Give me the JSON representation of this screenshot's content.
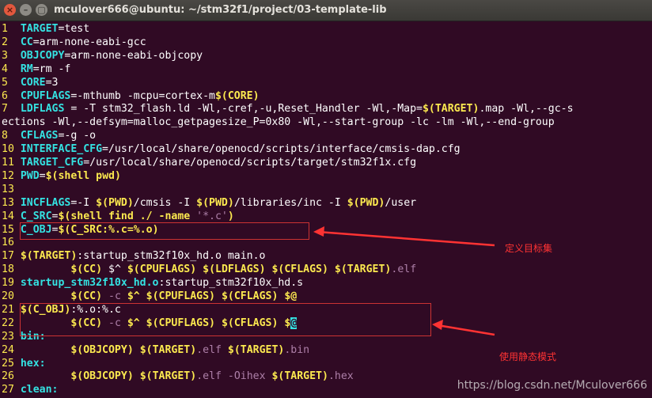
{
  "window": {
    "title": "mculover666@ubuntu: ~/stm32f1/project/03-template-lib",
    "close_glyph": "×",
    "min_glyph": "–",
    "max_glyph": "▢"
  },
  "lines": [
    {
      "n": "1",
      "segs": [
        {
          "t": "TARGET",
          "c": "cyan b"
        },
        {
          "t": "=test",
          "c": ""
        }
      ]
    },
    {
      "n": "2",
      "segs": [
        {
          "t": "CC",
          "c": "cyan b"
        },
        {
          "t": "=arm-none-eabi-gcc",
          "c": ""
        }
      ]
    },
    {
      "n": "3",
      "segs": [
        {
          "t": "OBJCOPY",
          "c": "cyan b"
        },
        {
          "t": "=arm-none-eabi-objcopy",
          "c": ""
        }
      ]
    },
    {
      "n": "4",
      "segs": [
        {
          "t": "RM",
          "c": "cyan b"
        },
        {
          "t": "=rm -f",
          "c": ""
        }
      ]
    },
    {
      "n": "5",
      "segs": [
        {
          "t": "CORE",
          "c": "cyan b"
        },
        {
          "t": "=3",
          "c": ""
        }
      ]
    },
    {
      "n": "6",
      "segs": [
        {
          "t": "CPUFLAGS",
          "c": "cyan b"
        },
        {
          "t": "=-mthumb -mcpu=cortex-m",
          "c": ""
        },
        {
          "t": "$(CORE)",
          "c": "yel b"
        }
      ]
    },
    {
      "n": "7",
      "segs": [
        {
          "t": "LDFLAGS",
          "c": "cyan b"
        },
        {
          "t": " = -T stm32_flash.ld -Wl,-cref,-u,Reset_Handler -Wl,-Map=",
          "c": ""
        },
        {
          "t": "$(TARGET)",
          "c": "yel b"
        },
        {
          "t": ".map -Wl,--gc-s",
          "c": ""
        }
      ]
    },
    {
      "n": "",
      "segs": [
        {
          "t": "ections -Wl,--defsym=malloc_getpagesize_P=0x80 -Wl,--start-group -lc -lm -Wl,--end-group",
          "c": ""
        }
      ]
    },
    {
      "n": "8",
      "segs": [
        {
          "t": "CFLAGS",
          "c": "cyan b"
        },
        {
          "t": "=-g -o",
          "c": ""
        }
      ]
    },
    {
      "n": "10",
      "segs": [
        {
          "t": "INTERFACE_CFG",
          "c": "cyan b"
        },
        {
          "t": "=/usr/local/share/openocd/scripts/interface/cmsis-dap.cfg",
          "c": ""
        }
      ]
    },
    {
      "n": "11",
      "segs": [
        {
          "t": "TARGET_CFG",
          "c": "cyan b"
        },
        {
          "t": "=/usr/local/share/openocd/scripts/target/stm32f1x.cfg",
          "c": ""
        }
      ]
    },
    {
      "n": "12",
      "segs": [
        {
          "t": "PWD",
          "c": "cyan b"
        },
        {
          "t": "=",
          "c": ""
        },
        {
          "t": "$(shell pwd)",
          "c": "yel b"
        }
      ]
    },
    {
      "n": "13",
      "segs": []
    },
    {
      "n": "13",
      "segs": [
        {
          "t": "INCFLAGS",
          "c": "cyan b"
        },
        {
          "t": "=-I ",
          "c": ""
        },
        {
          "t": "$(PWD)",
          "c": "yel b"
        },
        {
          "t": "/cmsis -I ",
          "c": ""
        },
        {
          "t": "$(PWD)",
          "c": "yel b"
        },
        {
          "t": "/libraries/inc -I ",
          "c": ""
        },
        {
          "t": "$(PWD)",
          "c": "yel b"
        },
        {
          "t": "/user",
          "c": ""
        }
      ]
    },
    {
      "n": "14",
      "segs": [
        {
          "t": "C_SRC",
          "c": "cyan b"
        },
        {
          "t": "=",
          "c": ""
        },
        {
          "t": "$(shell find ./ -name ",
          "c": "yel b"
        },
        {
          "t": "'*.c'",
          "c": "str"
        },
        {
          "t": ")",
          "c": "yel b"
        }
      ]
    },
    {
      "n": "15",
      "segs": [
        {
          "t": "C_OBJ",
          "c": "cyan b"
        },
        {
          "t": "=",
          "c": ""
        },
        {
          "t": "$(C_SRC:%.c=%.o)",
          "c": "yel b"
        }
      ]
    },
    {
      "n": "16",
      "segs": []
    },
    {
      "n": "17",
      "segs": [
        {
          "t": "$(TARGET)",
          "c": "yel b"
        },
        {
          "t": ":startup_stm32f10x_hd.o main.o",
          "c": ""
        }
      ]
    },
    {
      "n": "18",
      "segs": [
        {
          "t": "        ",
          "c": ""
        },
        {
          "t": "$(CC)",
          "c": "yel b"
        },
        {
          "t": " $^ ",
          "c": ""
        },
        {
          "t": "$(CPUFLAGS)",
          "c": "yel b"
        },
        {
          "t": " ",
          "c": ""
        },
        {
          "t": "$(LDFLAGS)",
          "c": "yel b"
        },
        {
          "t": " ",
          "c": ""
        },
        {
          "t": "$(CFLAGS)",
          "c": "yel b"
        },
        {
          "t": " ",
          "c": ""
        },
        {
          "t": "$(TARGET)",
          "c": "yel b"
        },
        {
          "t": ".elf",
          "c": "str"
        }
      ]
    },
    {
      "n": "19",
      "segs": [
        {
          "t": "startup_stm32f10x_hd.o",
          "c": "cyan b"
        },
        {
          "t": ":startup_stm32f10x_hd.s",
          "c": ""
        }
      ]
    },
    {
      "n": "20",
      "segs": [
        {
          "t": "        ",
          "c": ""
        },
        {
          "t": "$(CC)",
          "c": "yel b"
        },
        {
          "t": " -c ",
          "c": "str"
        },
        {
          "t": "$^ ",
          "c": "yel b"
        },
        {
          "t": "$(CPUFLAGS)",
          "c": "yel b"
        },
        {
          "t": " ",
          "c": ""
        },
        {
          "t": "$(CFLAGS)",
          "c": "yel b"
        },
        {
          "t": " $@",
          "c": "yel b"
        }
      ]
    },
    {
      "n": "21",
      "segs": [
        {
          "t": "$(C_OBJ)",
          "c": "yel b"
        },
        {
          "t": ":%.o:%.c",
          "c": ""
        }
      ]
    },
    {
      "n": "22",
      "segs": [
        {
          "t": "        ",
          "c": ""
        },
        {
          "t": "$(CC)",
          "c": "yel b"
        },
        {
          "t": " -c ",
          "c": "str"
        },
        {
          "t": "$^ ",
          "c": "yel b"
        },
        {
          "t": "$(CPUFLAGS)",
          "c": "yel b"
        },
        {
          "t": " ",
          "c": ""
        },
        {
          "t": "$(CFLAGS)",
          "c": "yel b"
        },
        {
          "t": " $",
          "c": "yel b"
        },
        {
          "t": "@",
          "c": "cursor b"
        }
      ]
    },
    {
      "n": "23",
      "segs": [
        {
          "t": "bin:",
          "c": "cyan b"
        }
      ]
    },
    {
      "n": "24",
      "segs": [
        {
          "t": "        ",
          "c": ""
        },
        {
          "t": "$(OBJCOPY)",
          "c": "yel b"
        },
        {
          "t": " ",
          "c": ""
        },
        {
          "t": "$(TARGET)",
          "c": "yel b"
        },
        {
          "t": ".elf ",
          "c": "str"
        },
        {
          "t": "$(TARGET)",
          "c": "yel b"
        },
        {
          "t": ".bin",
          "c": "str"
        }
      ]
    },
    {
      "n": "25",
      "segs": [
        {
          "t": "hex:",
          "c": "cyan b"
        }
      ]
    },
    {
      "n": "26",
      "segs": [
        {
          "t": "        ",
          "c": ""
        },
        {
          "t": "$(OBJCOPY)",
          "c": "yel b"
        },
        {
          "t": " ",
          "c": ""
        },
        {
          "t": "$(TARGET)",
          "c": "yel b"
        },
        {
          "t": ".elf -Oihex ",
          "c": "str"
        },
        {
          "t": "$(TARGET)",
          "c": "yel b"
        },
        {
          "t": ".hex",
          "c": "str"
        }
      ]
    },
    {
      "n": "27",
      "segs": [
        {
          "t": "clean:",
          "c": "cyan b"
        }
      ]
    }
  ],
  "annotations": {
    "note1": "定义目标集",
    "note2": "使用静态模式",
    "accent": "#cc3333"
  },
  "watermark": "https://blog.csdn.net/Mculover666"
}
